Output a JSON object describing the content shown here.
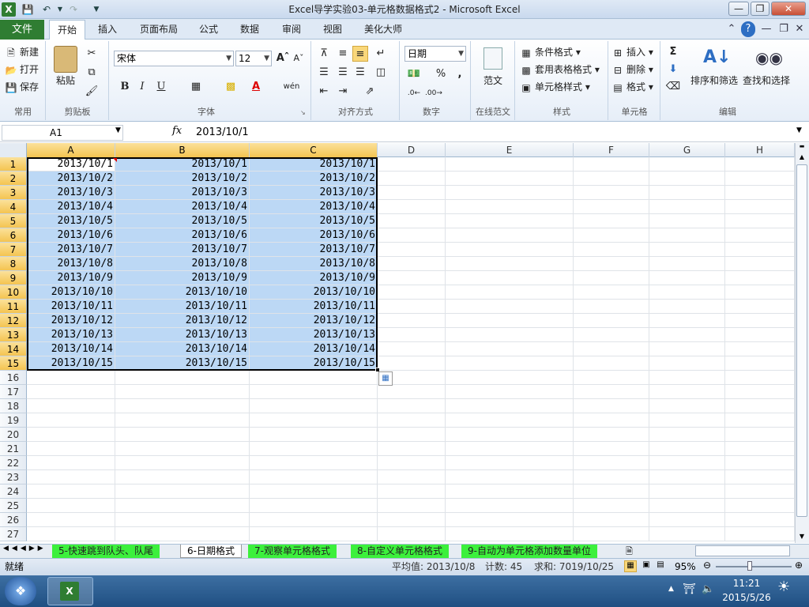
{
  "window": {
    "title": "Excel导学实验03-单元格数据格式2  -  Microsoft Excel"
  },
  "ribbon_tabs": [
    "文件",
    "开始",
    "插入",
    "页面布局",
    "公式",
    "数据",
    "审阅",
    "视图",
    "美化大师"
  ],
  "ribbon": {
    "common": {
      "label": "常用",
      "new": "新建",
      "open": "打开",
      "save": "保存"
    },
    "clipboard": {
      "label": "剪贴板",
      "paste": "粘贴"
    },
    "font": {
      "label": "字体",
      "name": "宋体",
      "size": "12",
      "bold": "B",
      "italic": "I",
      "underline": "U",
      "wen": "wén",
      "font_color": "A"
    },
    "align": {
      "label": "对齐方式"
    },
    "number": {
      "label": "数字",
      "format": "日期",
      "percent": "%",
      "comma": ","
    },
    "template": {
      "label": "在线范文",
      "button": "范文"
    },
    "styles": {
      "label": "样式",
      "conditional": "条件格式",
      "table": "套用表格格式",
      "cell": "单元格样式"
    },
    "cells": {
      "label": "单元格",
      "insert": "插入",
      "delete": "删除",
      "format": "格式"
    },
    "editing": {
      "label": "编辑",
      "sort": "排序和筛选",
      "find": "查找和选择",
      "sigma": "Σ"
    }
  },
  "formula_bar": {
    "name_box": "A1",
    "fx": "fx",
    "value": "2013/10/1"
  },
  "columns": [
    "A",
    "B",
    "C",
    "D",
    "E",
    "F",
    "G",
    "H"
  ],
  "rows": [
    "1",
    "2",
    "3",
    "4",
    "5",
    "6",
    "7",
    "8",
    "9",
    "10",
    "11",
    "12",
    "13",
    "14",
    "15",
    "16",
    "17",
    "18",
    "19",
    "20",
    "21",
    "22",
    "23",
    "24",
    "25",
    "26",
    "27"
  ],
  "data": [
    [
      "2013/10/1",
      "2013/10/1",
      "2013/10/1"
    ],
    [
      "2013/10/2",
      "2013/10/2",
      "2013/10/2"
    ],
    [
      "2013/10/3",
      "2013/10/3",
      "2013/10/3"
    ],
    [
      "2013/10/4",
      "2013/10/4",
      "2013/10/4"
    ],
    [
      "2013/10/5",
      "2013/10/5",
      "2013/10/5"
    ],
    [
      "2013/10/6",
      "2013/10/6",
      "2013/10/6"
    ],
    [
      "2013/10/7",
      "2013/10/7",
      "2013/10/7"
    ],
    [
      "2013/10/8",
      "2013/10/8",
      "2013/10/8"
    ],
    [
      "2013/10/9",
      "2013/10/9",
      "2013/10/9"
    ],
    [
      "2013/10/10",
      "2013/10/10",
      "2013/10/10"
    ],
    [
      "2013/10/11",
      "2013/10/11",
      "2013/10/11"
    ],
    [
      "2013/10/12",
      "2013/10/12",
      "2013/10/12"
    ],
    [
      "2013/10/13",
      "2013/10/13",
      "2013/10/13"
    ],
    [
      "2013/10/14",
      "2013/10/14",
      "2013/10/14"
    ],
    [
      "2013/10/15",
      "2013/10/15",
      "2013/10/15"
    ]
  ],
  "sheet_tabs": [
    {
      "label": "5-快速跳到队头、队尾",
      "active": false
    },
    {
      "label": "6-日期格式",
      "active": true
    },
    {
      "label": "7-观察单元格格式",
      "active": false
    },
    {
      "label": "8-自定义单元格格式",
      "active": false
    },
    {
      "label": "9-自动为单元格添加数量单位",
      "active": false
    }
  ],
  "status": {
    "ready": "就绪",
    "average": "平均值: 2013/10/8",
    "count": "计数: 45",
    "sum": "求和: 7019/10/25",
    "zoom": "95%"
  },
  "taskbar": {
    "time": "11:21",
    "date": "2015/5/26"
  },
  "colors": {
    "file_tab": "#2f7d32",
    "selection": "#bcd8f5",
    "header_selected": "#f4c451",
    "sheet_tab": "#3cf03c"
  }
}
